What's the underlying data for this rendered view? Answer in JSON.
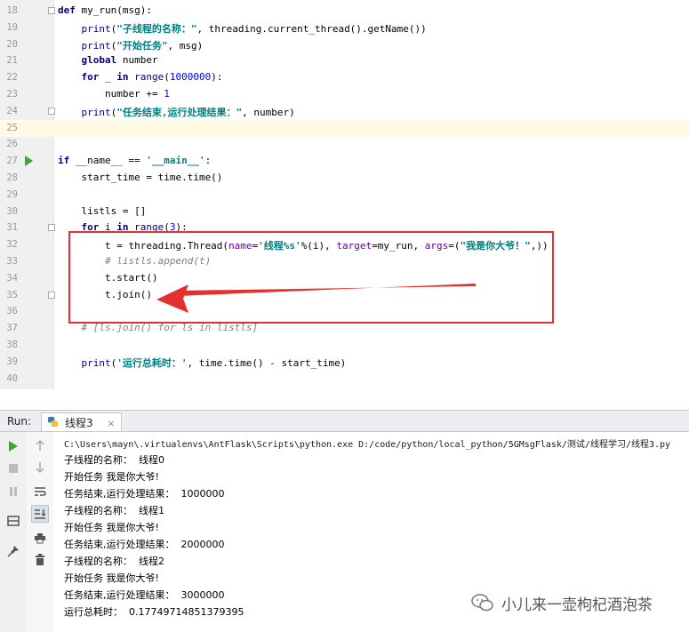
{
  "editor": {
    "lines": [
      {
        "n": "18",
        "parts": [
          {
            "c": "kw",
            "t": "def "
          },
          {
            "t": "my_run(msg):"
          }
        ]
      },
      {
        "n": "19",
        "parts": [
          {
            "t": "    "
          },
          {
            "c": "bi",
            "t": "print"
          },
          {
            "t": "("
          },
          {
            "c": "str",
            "t": "\"子线程的名称：\""
          },
          {
            "t": ", threading.current_thread().getName())"
          }
        ]
      },
      {
        "n": "20",
        "parts": [
          {
            "t": "    "
          },
          {
            "c": "bi",
            "t": "print"
          },
          {
            "t": "("
          },
          {
            "c": "str",
            "t": "\"开始任务\""
          },
          {
            "t": ", msg)"
          }
        ]
      },
      {
        "n": "21",
        "parts": [
          {
            "t": "    "
          },
          {
            "c": "kw",
            "t": "global "
          },
          {
            "t": "number"
          }
        ]
      },
      {
        "n": "22",
        "parts": [
          {
            "t": "    "
          },
          {
            "c": "kw",
            "t": "for "
          },
          {
            "t": "_ "
          },
          {
            "c": "kw",
            "t": "in "
          },
          {
            "c": "bi",
            "t": "range"
          },
          {
            "t": "("
          },
          {
            "c": "num",
            "t": "1000000"
          },
          {
            "t": "):"
          }
        ]
      },
      {
        "n": "23",
        "parts": [
          {
            "t": "        number += "
          },
          {
            "c": "num",
            "t": "1"
          }
        ]
      },
      {
        "n": "24",
        "parts": [
          {
            "t": "    "
          },
          {
            "c": "bi",
            "t": "print"
          },
          {
            "t": "("
          },
          {
            "c": "str",
            "t": "\"任务结束,运行处理结果：\""
          },
          {
            "t": ", number)"
          }
        ]
      },
      {
        "n": "25",
        "parts": []
      },
      {
        "n": "26",
        "parts": []
      },
      {
        "n": "27",
        "parts": [
          {
            "c": "kw",
            "t": "if "
          },
          {
            "t": "__name__ == "
          },
          {
            "c": "str",
            "t": "'__main__'"
          },
          {
            "t": ":"
          }
        ]
      },
      {
        "n": "28",
        "parts": [
          {
            "t": "    start_time = time.time()"
          }
        ]
      },
      {
        "n": "29",
        "parts": []
      },
      {
        "n": "30",
        "parts": [
          {
            "t": "    listls = []"
          }
        ]
      },
      {
        "n": "31",
        "parts": [
          {
            "t": "    "
          },
          {
            "c": "kw",
            "t": "for "
          },
          {
            "t": "i "
          },
          {
            "c": "kw",
            "t": "in "
          },
          {
            "c": "bi",
            "t": "range"
          },
          {
            "t": "("
          },
          {
            "c": "num",
            "t": "3"
          },
          {
            "t": "):"
          }
        ]
      },
      {
        "n": "32",
        "parts": [
          {
            "t": "        t = threading.Thread("
          },
          {
            "c": "prm",
            "t": "name"
          },
          {
            "t": "="
          },
          {
            "c": "str",
            "t": "'线程%s'"
          },
          {
            "t": "%(i), "
          },
          {
            "c": "prm",
            "t": "target"
          },
          {
            "t": "=my_run, "
          },
          {
            "c": "prm",
            "t": "args"
          },
          {
            "t": "=("
          },
          {
            "c": "str",
            "t": "\"我是你大爷！\""
          },
          {
            "t": ",))"
          }
        ]
      },
      {
        "n": "33",
        "parts": [
          {
            "t": "        "
          },
          {
            "c": "cmt",
            "t": "# listls.append(t)"
          }
        ]
      },
      {
        "n": "34",
        "parts": [
          {
            "t": "        t.start()"
          }
        ]
      },
      {
        "n": "35",
        "parts": [
          {
            "t": "        t.join()"
          }
        ]
      },
      {
        "n": "36",
        "parts": []
      },
      {
        "n": "37",
        "parts": [
          {
            "t": "    "
          },
          {
            "c": "cmt",
            "t": "# [ls.join() for ls in listls]"
          }
        ]
      },
      {
        "n": "38",
        "parts": []
      },
      {
        "n": "39",
        "parts": [
          {
            "t": "    "
          },
          {
            "c": "bi",
            "t": "print"
          },
          {
            "t": "("
          },
          {
            "c": "str",
            "t": "'运行总耗时：'"
          },
          {
            "t": ", time.time() - start_time)"
          }
        ]
      },
      {
        "n": "40",
        "parts": []
      }
    ]
  },
  "run_panel": {
    "label": "Run:",
    "tab_name": "线程3",
    "tab_close": "×"
  },
  "console": {
    "command": "C:\\Users\\mayn\\.virtualenvs\\AntFlask\\Scripts\\python.exe D:/code/python/local_python/5GMsgFlask/测试/线程学习/线程3.py",
    "output": [
      "子线程的名称：  线程0",
      "开始任务 我是你大爷!",
      "任务结束,运行处理结果：  1000000",
      "子线程的名称：  线程1",
      "开始任务 我是你大爷!",
      "任务结束,运行处理结果：  2000000",
      "子线程的名称：  线程2",
      "开始任务 我是你大爷!",
      "任务结束,运行处理结果：  3000000",
      "运行总耗时：  0.17749714851379395"
    ]
  },
  "watermark": {
    "text": "小儿来一壶枸杞酒泡茶"
  },
  "colors": {
    "highlight_box": "#e53030",
    "run_green": "#4a9e3f",
    "keyword": "#000080",
    "string": "#008080"
  },
  "icons": [
    "run-icon",
    "stop-icon",
    "pause-icon",
    "up-arrow-icon",
    "down-arrow-icon",
    "soft-wrap-icon",
    "scroll-to-end-icon",
    "print-icon",
    "layout-icon",
    "pin-icon",
    "trash-icon",
    "python-icon",
    "wechat-icon"
  ]
}
